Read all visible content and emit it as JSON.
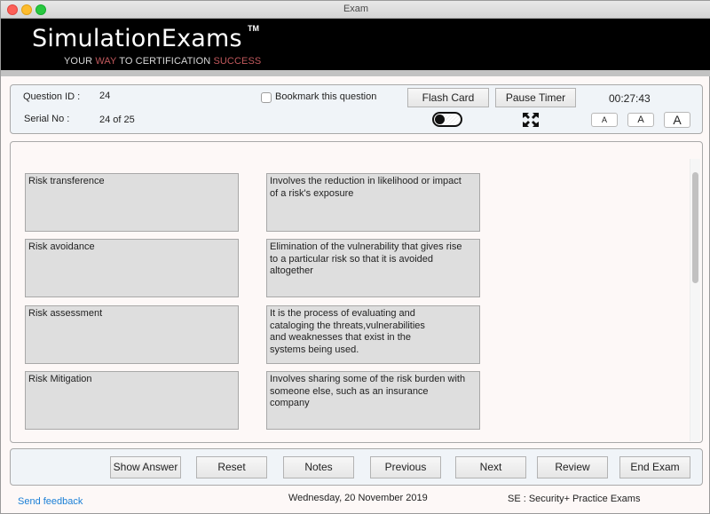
{
  "window": {
    "title": "Exam"
  },
  "banner": {
    "brand": "SimulationExams",
    "trademark": "TM",
    "tagline_parts": [
      "YOUR ",
      "WAY",
      " TO CERTIFICATION ",
      "SUCCESS"
    ],
    "accent_color": "#c0585c"
  },
  "info": {
    "question_id_label": "Question ID :",
    "question_id_value": "24",
    "serial_label": "Serial No :",
    "serial_value": "24 of 25",
    "bookmark_label": "Bookmark this question",
    "bookmark_checked": false,
    "flash_card_label": "Flash Card",
    "flash_card_toggle_on": false,
    "pause_timer_label": "Pause Timer",
    "timer": "00:27:43",
    "fullscreen_icon": "expand-arrows-icon",
    "font_sizes": [
      "A",
      "A",
      "A"
    ]
  },
  "matching": {
    "terms": [
      "Risk transference",
      "Risk avoidance",
      "Risk assessment",
      "Risk Mitigation"
    ],
    "definitions": [
      "Involves the reduction in likelihood or impact\nof a risk's exposure",
      "Elimination of the vulnerability that gives rise\nto a particular risk so that it is avoided\naltogether",
      "It is the process of evaluating and\ncataloging the threats,vulnerabilities\nand weaknesses that exist in the\nsystems being used.",
      "Involves sharing some of the risk burden with\nsomeone else, such as an insurance\ncompany"
    ]
  },
  "nav": {
    "show_answer": "Show Answer",
    "reset": "Reset",
    "notes": "Notes",
    "previous": "Previous",
    "next": "Next",
    "review": "Review",
    "end_exam": "End Exam"
  },
  "footer": {
    "feedback": "Send feedback",
    "date": "Wednesday, 20 November 2019",
    "product": "SE : Security+ Practice Exams",
    "link_color": "#1a7fd6"
  }
}
